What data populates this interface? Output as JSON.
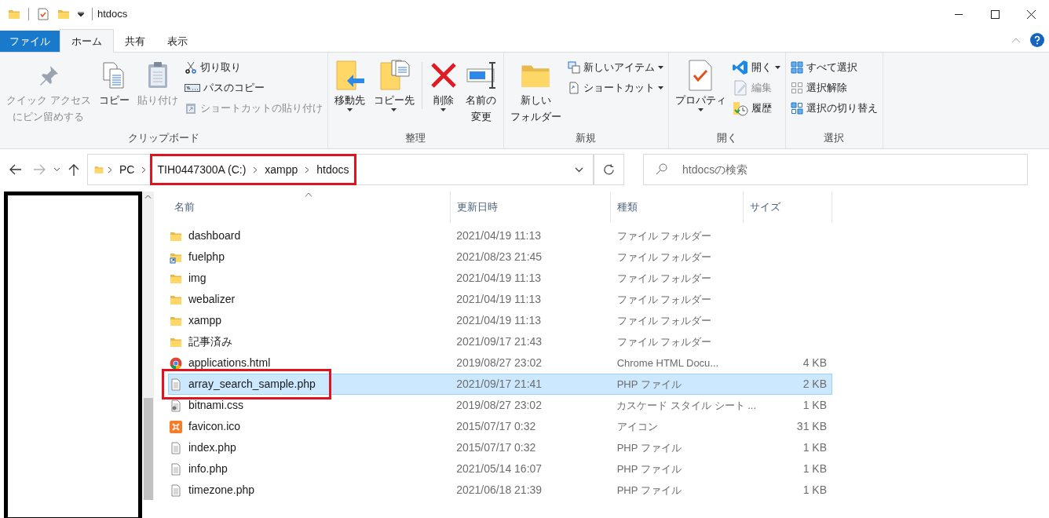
{
  "title_bar": {
    "title": "htdocs"
  },
  "ribbon_tabs": [
    {
      "label": "ファイル",
      "kind": "file",
      "selected": false
    },
    {
      "label": "ホーム",
      "kind": "tab",
      "selected": true
    },
    {
      "label": "共有",
      "kind": "tab",
      "selected": false
    },
    {
      "label": "表示",
      "kind": "tab",
      "selected": false
    }
  ],
  "ribbon_groups": [
    {
      "label": "クリップボード",
      "items": [
        {
          "kind": "large",
          "lines": [
            "クイック アクセス",
            "にピン留めする"
          ],
          "disabled": true,
          "dropdown": false
        },
        {
          "kind": "large",
          "lines": [
            "コピー"
          ],
          "disabled": false,
          "dropdown": false
        },
        {
          "kind": "large",
          "lines": [
            "貼り付け"
          ],
          "disabled": true,
          "dropdown": false
        },
        {
          "kind": "stack",
          "items": [
            {
              "label": "切り取り",
              "disabled": false,
              "dropdown": false
            },
            {
              "label": "パスのコピー",
              "disabled": false,
              "dropdown": false
            },
            {
              "label": "ショートカットの貼り付け",
              "disabled": true,
              "dropdown": false
            }
          ]
        }
      ]
    },
    {
      "label": "整理",
      "items": [
        {
          "kind": "large",
          "lines": [
            "移動先"
          ],
          "disabled": false,
          "dropdown": true
        },
        {
          "kind": "large",
          "lines": [
            "コピー先"
          ],
          "disabled": false,
          "dropdown": true
        },
        {
          "kind": "separator"
        },
        {
          "kind": "large",
          "lines": [
            "削除"
          ],
          "disabled": false,
          "dropdown": true
        },
        {
          "kind": "large",
          "lines": [
            "名前の",
            "変更"
          ],
          "disabled": false,
          "dropdown": false
        }
      ]
    },
    {
      "label": "新規",
      "items": [
        {
          "kind": "large",
          "lines": [
            "新しい",
            "フォルダー"
          ],
          "disabled": false,
          "dropdown": false
        },
        {
          "kind": "stack",
          "items": [
            {
              "label": "新しいアイテム",
              "disabled": false,
              "dropdown": true
            },
            {
              "label": "ショートカット",
              "disabled": false,
              "dropdown": true
            }
          ]
        }
      ]
    },
    {
      "label": "開く",
      "items": [
        {
          "kind": "large",
          "lines": [
            "プロパティ"
          ],
          "disabled": false,
          "dropdown": true
        },
        {
          "kind": "stack",
          "items": [
            {
              "label": "開く",
              "disabled": false,
              "dropdown": true
            },
            {
              "label": "編集",
              "disabled": true,
              "dropdown": false
            },
            {
              "label": "履歴",
              "disabled": false,
              "dropdown": false
            }
          ]
        }
      ]
    },
    {
      "label": "選択",
      "items": [
        {
          "kind": "stack",
          "items": [
            {
              "label": "すべて選択",
              "disabled": false,
              "dropdown": false
            },
            {
              "label": "選択解除",
              "disabled": false,
              "dropdown": false
            },
            {
              "label": "選択の切り替え",
              "disabled": false,
              "dropdown": false
            }
          ]
        }
      ]
    }
  ],
  "address_bar": {
    "path": [
      {
        "label": "PC",
        "highlighted": false
      },
      {
        "label": "TIH0447300A (C:)",
        "highlighted": true
      },
      {
        "label": "xampp",
        "highlighted": true
      },
      {
        "label": "htdocs",
        "highlighted": true
      }
    ]
  },
  "search": {
    "placeholder": "htdocsの検索"
  },
  "table": {
    "columns": [
      {
        "label": "名前",
        "sorted": true
      },
      {
        "label": "更新日時",
        "sorted": false
      },
      {
        "label": "種類",
        "sorted": false
      },
      {
        "label": "サイズ",
        "sorted": false
      }
    ],
    "rows": [
      {
        "kind": "folder",
        "name": "dashboard",
        "modified": "2021/04/19 11:13",
        "type": "ファイル フォルダー",
        "selected": false,
        "highlighted": false
      },
      {
        "kind": "folder-link",
        "name": "fuelphp",
        "modified": "2021/08/23 21:45",
        "type": "ファイル フォルダー",
        "selected": false,
        "highlighted": false
      },
      {
        "kind": "folder",
        "name": "img",
        "modified": "2021/04/19 11:13",
        "type": "ファイル フォルダー",
        "selected": false,
        "highlighted": false
      },
      {
        "kind": "folder",
        "name": "webalizer",
        "modified": "2021/04/19 11:13",
        "type": "ファイル フォルダー",
        "selected": false,
        "highlighted": false
      },
      {
        "kind": "folder",
        "name": "xampp",
        "modified": "2021/04/19 11:13",
        "type": "ファイル フォルダー",
        "selected": false,
        "highlighted": false
      },
      {
        "kind": "folder",
        "name": "記事済み",
        "modified": "2021/09/17 21:43",
        "type": "ファイル フォルダー",
        "selected": false,
        "highlighted": false
      },
      {
        "kind": "browser",
        "name": "applications.html",
        "modified": "2019/08/27 23:02",
        "type": "Chrome HTML Docu...",
        "size": "4 KB",
        "selected": false,
        "highlighted": false
      },
      {
        "kind": "file",
        "name": "array_search_sample.php",
        "modified": "2021/09/17 21:41",
        "type": "PHP ファイル",
        "size": "2 KB",
        "selected": true,
        "highlighted": true
      },
      {
        "kind": "stylesheet",
        "name": "bitnami.css",
        "modified": "2019/08/27 23:02",
        "type": "カスケード スタイル シート ...",
        "size": "1 KB",
        "selected": false,
        "highlighted": false
      },
      {
        "kind": "app",
        "name": "favicon.ico",
        "modified": "2015/07/17 0:32",
        "type": "アイコン",
        "size": "31 KB",
        "selected": false,
        "highlighted": false
      },
      {
        "kind": "file",
        "name": "index.php",
        "modified": "2015/07/17 0:32",
        "type": "PHP ファイル",
        "size": "1 KB",
        "selected": false,
        "highlighted": false
      },
      {
        "kind": "file",
        "name": "info.php",
        "modified": "2021/05/14 16:07",
        "type": "PHP ファイル",
        "size": "1 KB",
        "selected": false,
        "highlighted": false
      },
      {
        "kind": "file",
        "name": "timezone.php",
        "modified": "2021/06/18 21:39",
        "type": "PHP ファイル",
        "size": "1 KB",
        "selected": false,
        "highlighted": false
      }
    ]
  }
}
